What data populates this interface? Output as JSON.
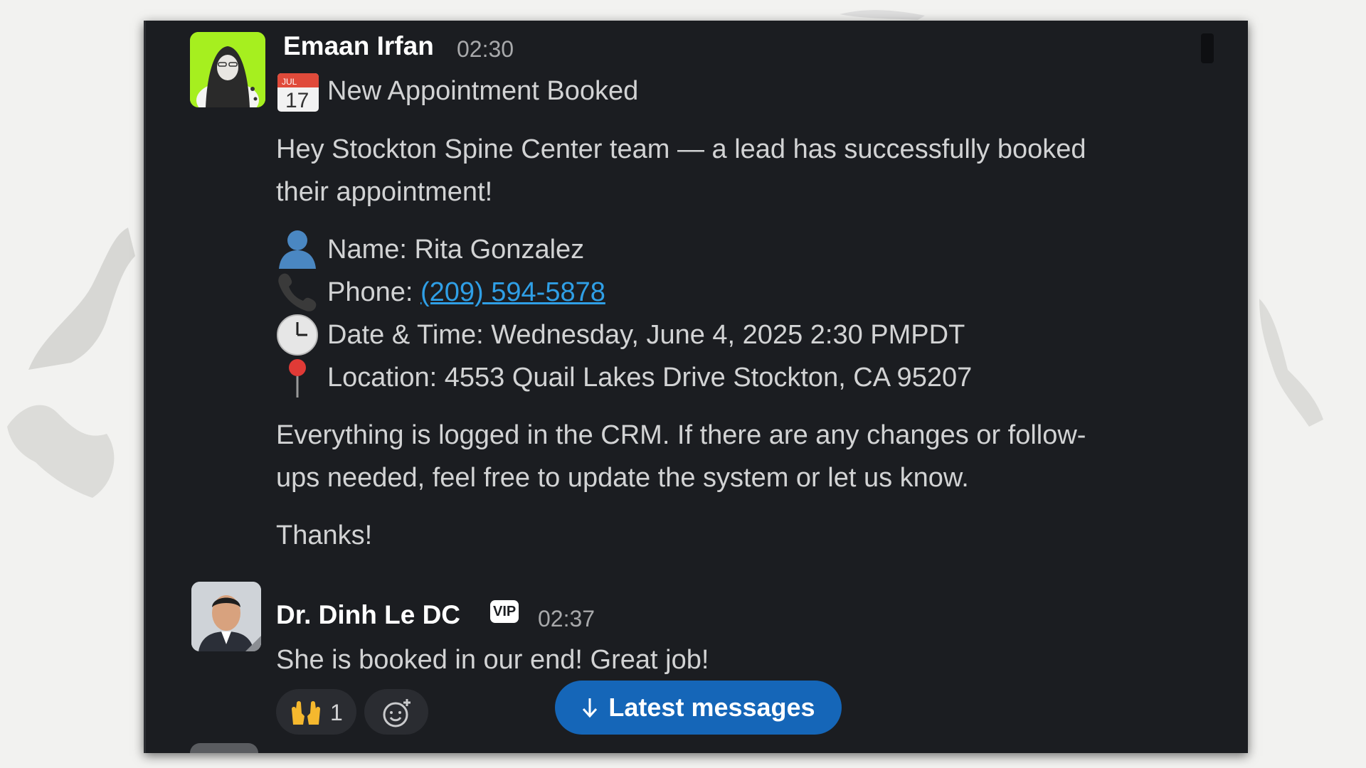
{
  "messages": {
    "first": {
      "sender": "Emaan Irfan",
      "time": "02:30",
      "calendar_month": "JUL",
      "calendar_day": "17",
      "heading": "New Appointment Booked",
      "intro_line1": "Hey Stockton Spine Center team — a lead has successfully booked",
      "intro_line2": "their appointment!",
      "name_line": "Name: Rita Gonzalez",
      "phone_label": "Phone: ",
      "phone_value": "(209) 594-5878",
      "datetime_line": "Date & Time: Wednesday, June 4, 2025 2:30 PMPDT",
      "location_line": "Location: 4553 Quail Lakes Drive Stockton, CA 95207",
      "crm_line1": "Everything is logged in the CRM. If there are any changes or follow-",
      "crm_line2": "ups needed, feel free to update the system or let us know.",
      "thanks": "Thanks!"
    },
    "second": {
      "sender": "Dr. Dinh Le DC",
      "badge": "VIP",
      "time": "02:37",
      "text": "She is booked in our end!  Great job!",
      "reaction_count": "1"
    }
  },
  "latest_button": "Latest messages",
  "icons": {
    "calendar": "calendar-icon",
    "person": "person-silhouette-icon",
    "phone": "telephone-receiver-icon",
    "clock": "clock-icon",
    "pin": "round-pushpin-icon",
    "raised_hands": "raising-hands-icon",
    "add_reaction": "add-reaction-icon",
    "arrow_down": "arrow-down-icon"
  },
  "colors": {
    "window_bg": "#1b1d21",
    "link": "#2f9fe6",
    "button": "#1566b8",
    "avatar_bg": "#a6ef1f"
  }
}
